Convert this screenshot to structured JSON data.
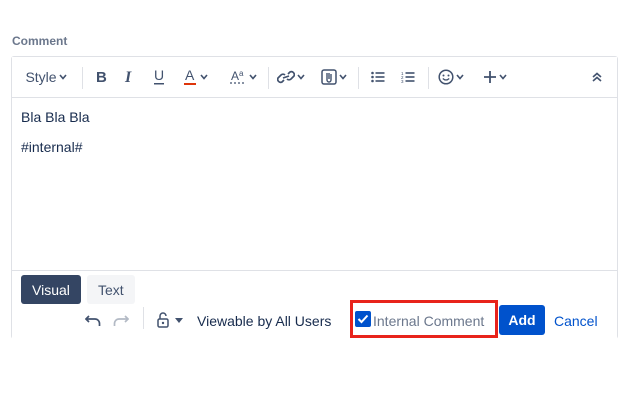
{
  "field": {
    "label": "Comment"
  },
  "toolbar": {
    "style_label": "Style",
    "icons": [
      "bold-icon",
      "italic-icon",
      "underline-icon",
      "text-color-icon",
      "text-effects-icon",
      "link-icon",
      "attachment-icon",
      "bullet-list-icon",
      "numbered-list-icon",
      "emoji-icon",
      "insert-more-icon",
      "collapse-toolbar-icon"
    ],
    "text_color_underline": "#de350b"
  },
  "editor": {
    "lines": [
      "Bla Bla Bla",
      "#internal#"
    ]
  },
  "modes": {
    "visual": "Visual",
    "text": "Text",
    "selected": "Visual"
  },
  "footer": {
    "viewable_label": "Viewable by All Users",
    "internal_label": "Internal Comment",
    "internal_checked": true,
    "add_label": "Add",
    "cancel_label": "Cancel"
  },
  "colors": {
    "primary": "#0052cc",
    "tab_selected": "#344563",
    "highlight_border": "#e8231b"
  }
}
